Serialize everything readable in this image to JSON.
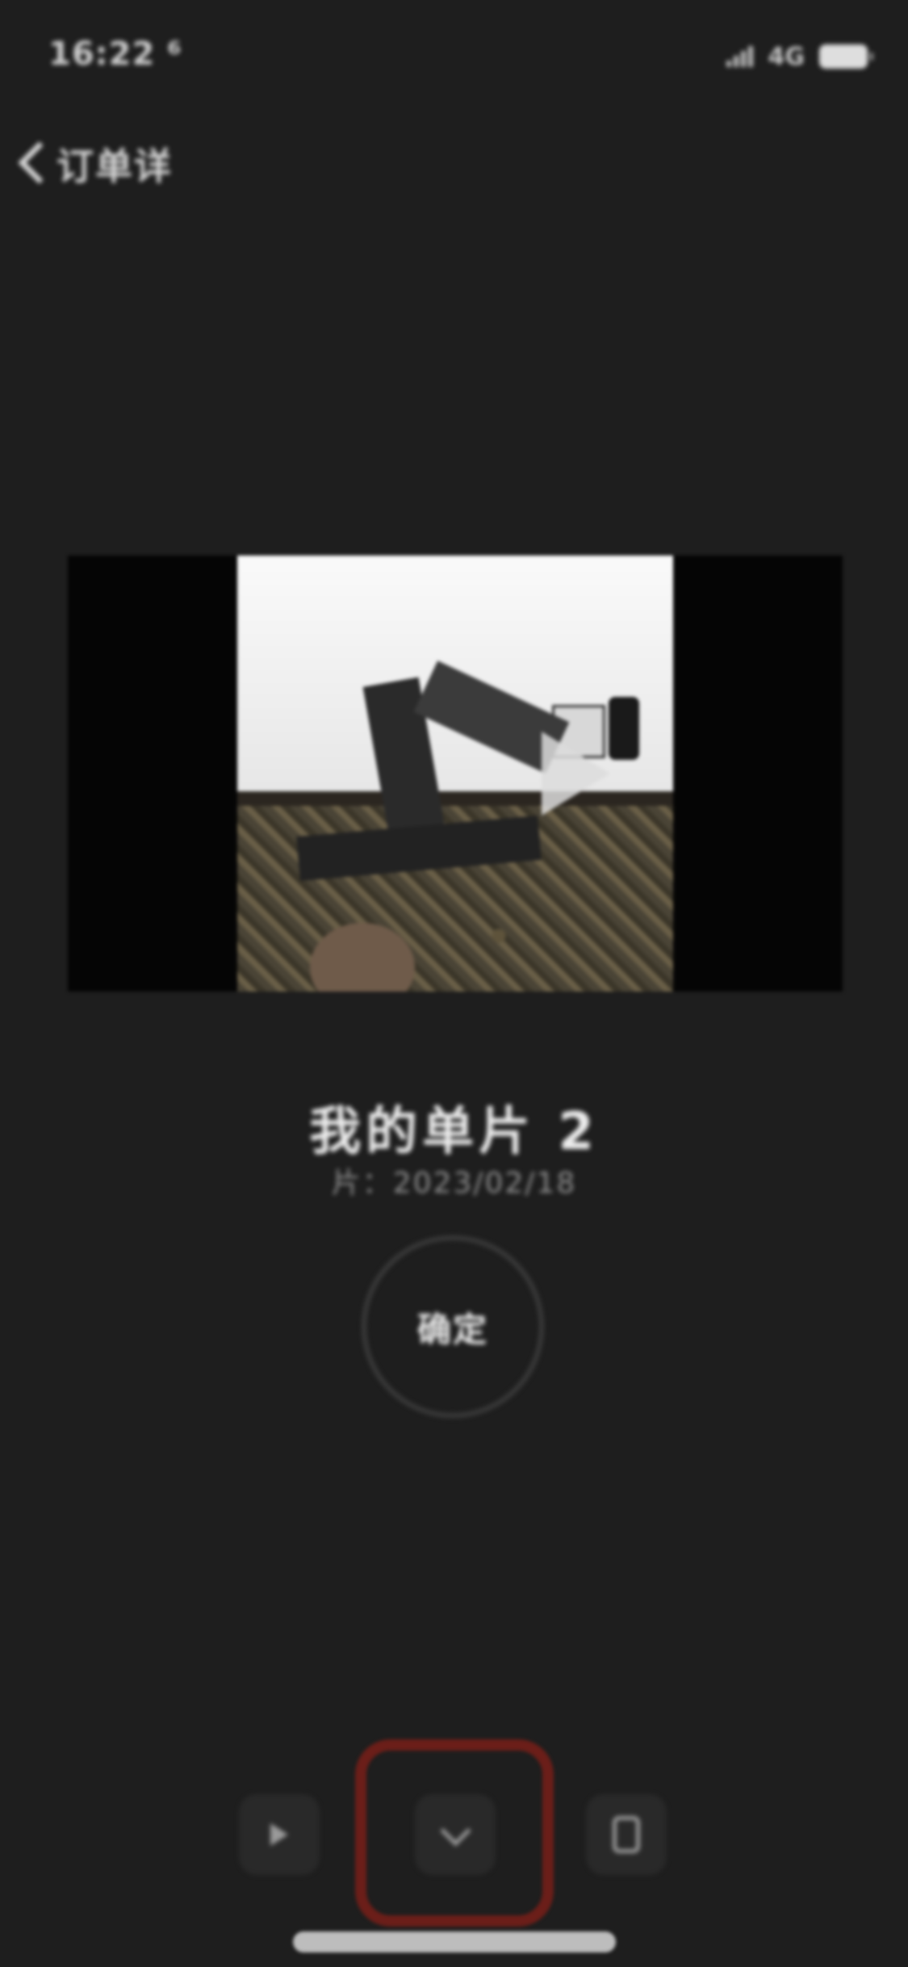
{
  "status_bar": {
    "time": "16:22 ⁶",
    "network": "4G"
  },
  "nav": {
    "back_label": "订单详"
  },
  "video": {
    "title": "我的单片 2",
    "subtitle": "片：2023/02/18"
  },
  "circle_action": {
    "label": "确定"
  },
  "toolbar": {
    "icons": [
      "play-icon",
      "chevron-down-icon",
      "document-icon"
    ]
  },
  "colors": {
    "background": "#1e1e1e",
    "highlight": "#6b1e19",
    "text_primary": "#ededed",
    "text_secondary": "#8f8f8f"
  }
}
